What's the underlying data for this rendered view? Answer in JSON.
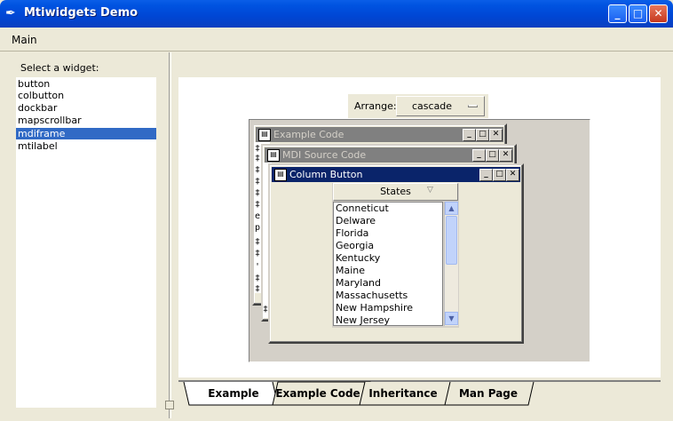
{
  "window": {
    "title": "Mtiwidgets Demo",
    "controls": {
      "minimize": "_",
      "maximize": "□",
      "close": "✕"
    }
  },
  "menu": {
    "items": [
      "Main"
    ]
  },
  "sidebar": {
    "label": "Select a widget:",
    "items": [
      "button",
      "colbutton",
      "dockbar",
      "mapscrollbar",
      "mdiframe",
      "mtilabel"
    ],
    "selected": "mdiframe"
  },
  "arrange": {
    "label": "Arrange:",
    "value": "cascade"
  },
  "mdi": {
    "windows": [
      {
        "title": "Example Code",
        "active": false
      },
      {
        "title": "MDI Source Code",
        "active": false
      },
      {
        "title": "Column Button",
        "active": true
      }
    ],
    "code_chars": [
      "‡",
      "‡",
      "‡",
      "‡",
      "‡",
      "‡",
      "e",
      "p",
      "‡",
      "‡",
      "'",
      "‡",
      "‡",
      "‡"
    ]
  },
  "colbutton": {
    "header": "States",
    "states": [
      "Conneticut",
      "Delware",
      "Florida",
      "Georgia",
      "Kentucky",
      "Maine",
      "Maryland",
      "Massachusetts",
      "New Hampshire",
      "New Jersey"
    ]
  },
  "tabs": {
    "items": [
      "Example",
      "Example Code",
      "Inheritance",
      "Man Page"
    ],
    "active": "Example"
  },
  "colors": {
    "title_bar": "#0054e3",
    "selection": "#316ac5",
    "mdi_active_title": "#0a246a",
    "mdi_inactive_title": "#808080"
  }
}
